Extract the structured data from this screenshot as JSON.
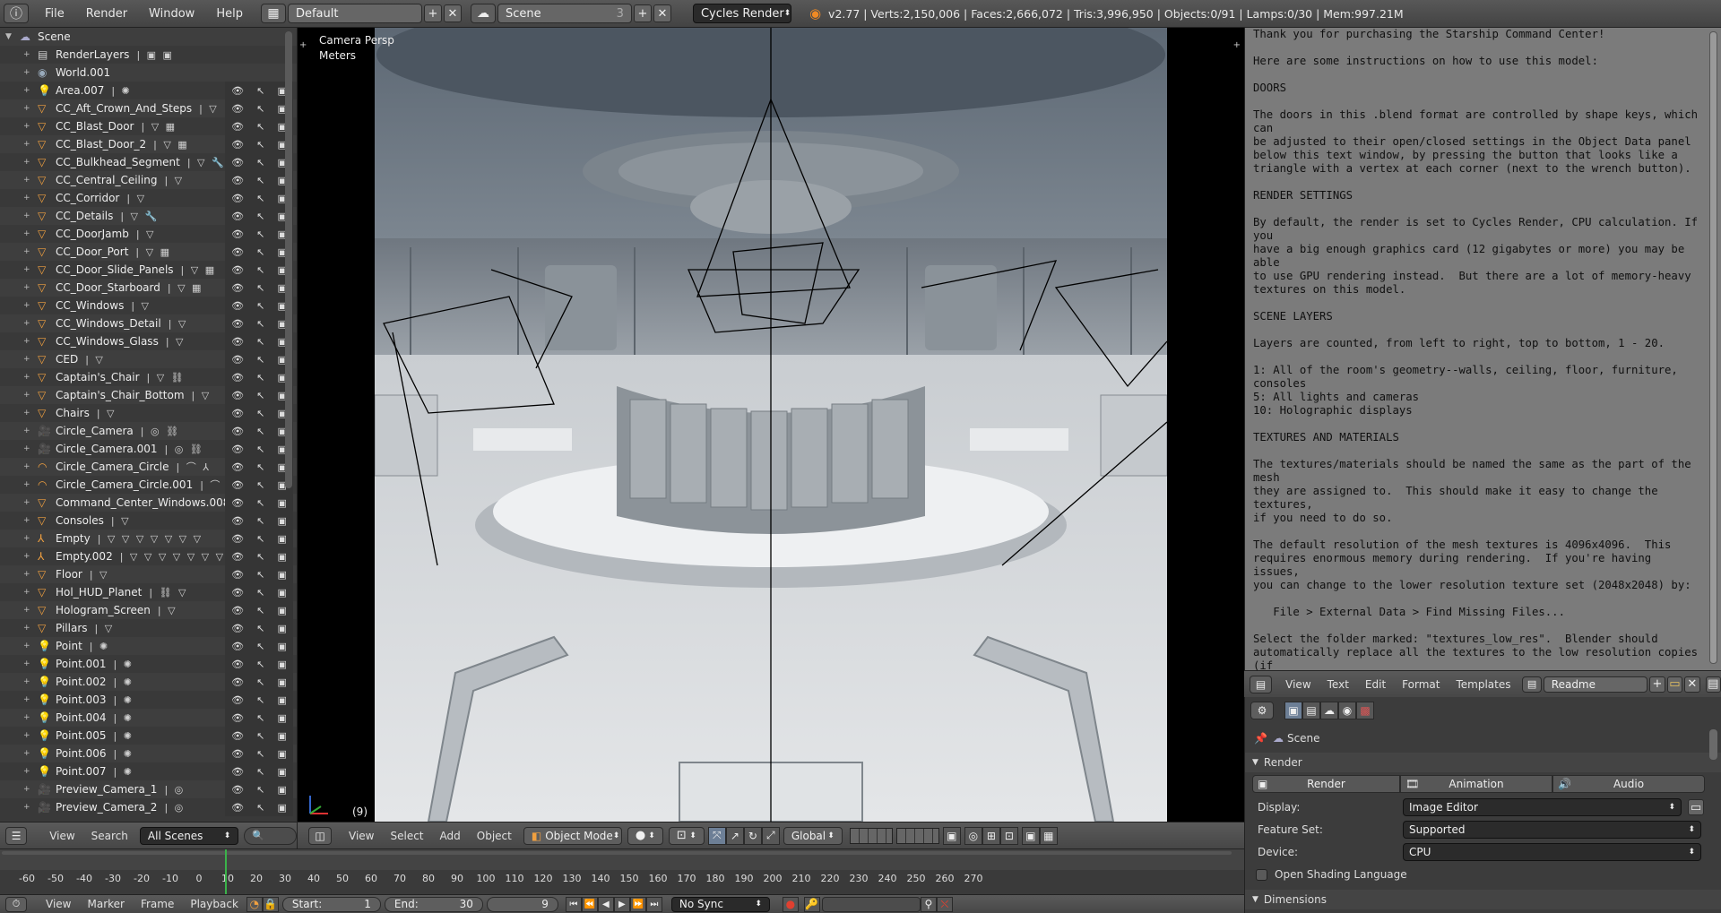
{
  "topbar": {
    "menus": [
      "File",
      "Render",
      "Window",
      "Help"
    ],
    "screen_layout": "Default",
    "scene": "Scene",
    "scene_users": "3",
    "render_engine": "Cycles Render",
    "stats": "v2.77 | Verts:2,150,006 | Faces:2,666,072 | Tris:3,996,950 | Objects:0/91 | Lamps:0/30 | Mem:997.21M"
  },
  "outliner": {
    "root": "Scene",
    "rows": [
      {
        "name": "RenderLayers",
        "icon": "renderlayers-icon",
        "glyph": "▤",
        "color": "#cfcfcf",
        "sub": "▣ ▣",
        "vis": false
      },
      {
        "name": "World.001",
        "icon": "world-icon",
        "glyph": "◉",
        "color": "#9ab",
        "sub": "",
        "vis": false
      },
      {
        "name": "Area.007",
        "icon": "lamp-icon",
        "glyph": "💡",
        "color": "#f0c060",
        "sub": "✺",
        "vis": true
      },
      {
        "name": "CC_Aft_Crown_And_Steps",
        "icon": "mesh-icon",
        "glyph": "▽",
        "color": "#f0a040",
        "sub": "▽",
        "vis": true
      },
      {
        "name": "CC_Blast_Door",
        "icon": "mesh-icon",
        "glyph": "▽",
        "color": "#f0a040",
        "sub": "▽ ▦",
        "vis": true
      },
      {
        "name": "CC_Blast_Door_2",
        "icon": "mesh-icon",
        "glyph": "▽",
        "color": "#f0a040",
        "sub": "▽ ▦",
        "vis": true
      },
      {
        "name": "CC_Bulkhead_Segment",
        "icon": "mesh-icon",
        "glyph": "▽",
        "color": "#f0a040",
        "sub": "▽ 🔧",
        "vis": true
      },
      {
        "name": "CC_Central_Ceiling",
        "icon": "mesh-icon",
        "glyph": "▽",
        "color": "#f0a040",
        "sub": "▽",
        "vis": true
      },
      {
        "name": "CC_Corridor",
        "icon": "mesh-icon",
        "glyph": "▽",
        "color": "#f0a040",
        "sub": "▽",
        "vis": true
      },
      {
        "name": "CC_Details",
        "icon": "mesh-icon",
        "glyph": "▽",
        "color": "#f0a040",
        "sub": "▽ 🔧",
        "vis": true
      },
      {
        "name": "CC_DoorJamb",
        "icon": "mesh-icon",
        "glyph": "▽",
        "color": "#f0a040",
        "sub": "▽",
        "vis": true
      },
      {
        "name": "CC_Door_Port",
        "icon": "mesh-icon",
        "glyph": "▽",
        "color": "#f0a040",
        "sub": "▽ ▦",
        "vis": true
      },
      {
        "name": "CC_Door_Slide_Panels",
        "icon": "mesh-icon",
        "glyph": "▽",
        "color": "#f0a040",
        "sub": "▽ ▦",
        "vis": true
      },
      {
        "name": "CC_Door_Starboard",
        "icon": "mesh-icon",
        "glyph": "▽",
        "color": "#f0a040",
        "sub": "▽ ▦",
        "vis": true
      },
      {
        "name": "CC_Windows",
        "icon": "mesh-icon",
        "glyph": "▽",
        "color": "#f0a040",
        "sub": "▽",
        "vis": true
      },
      {
        "name": "CC_Windows_Detail",
        "icon": "mesh-icon",
        "glyph": "▽",
        "color": "#f0a040",
        "sub": "▽",
        "vis": true
      },
      {
        "name": "CC_Windows_Glass",
        "icon": "mesh-icon",
        "glyph": "▽",
        "color": "#f0a040",
        "sub": "▽",
        "vis": true
      },
      {
        "name": "CED",
        "icon": "mesh-icon",
        "glyph": "▽",
        "color": "#f0a040",
        "sub": "▽",
        "vis": true
      },
      {
        "name": "Captain's_Chair",
        "icon": "mesh-icon",
        "glyph": "▽",
        "color": "#f0a040",
        "sub": "▽ ⛓",
        "vis": true
      },
      {
        "name": "Captain's_Chair_Bottom",
        "icon": "mesh-icon",
        "glyph": "▽",
        "color": "#f0a040",
        "sub": "▽",
        "vis": true
      },
      {
        "name": "Chairs",
        "icon": "mesh-icon",
        "glyph": "▽",
        "color": "#f0a040",
        "sub": "▽",
        "vis": true
      },
      {
        "name": "Circle_Camera",
        "icon": "camera-icon",
        "glyph": "🎥",
        "color": "#f0a040",
        "sub": "◎ ⛓",
        "vis": true
      },
      {
        "name": "Circle_Camera.001",
        "icon": "camera-icon",
        "glyph": "🎥",
        "color": "#f0a040",
        "sub": "◎ ⛓",
        "vis": true
      },
      {
        "name": "Circle_Camera_Circle",
        "icon": "curve-icon",
        "glyph": "◠",
        "color": "#f0a040",
        "sub": "⌒ ⅄",
        "vis": true
      },
      {
        "name": "Circle_Camera_Circle.001",
        "icon": "curve-icon",
        "glyph": "◠",
        "color": "#f0a040",
        "sub": "⌒ ⅄",
        "vis": true
      },
      {
        "name": "Command_Center_Windows.008",
        "icon": "mesh-icon",
        "glyph": "▽",
        "color": "#f0a040",
        "sub": "▽",
        "vis": true
      },
      {
        "name": "Consoles",
        "icon": "mesh-icon",
        "glyph": "▽",
        "color": "#f0a040",
        "sub": "▽",
        "vis": true
      },
      {
        "name": "Empty",
        "icon": "empty-icon",
        "glyph": "⅄",
        "color": "#f0a040",
        "sub": "▽ ▽ ▽ ▽ ▽ ▽ ▽",
        "vis": true
      },
      {
        "name": "Empty.002",
        "icon": "empty-icon",
        "glyph": "⅄",
        "color": "#f0a040",
        "sub": "▽ ▽ ▽ ▽ ▽ ▽ ▽",
        "vis": true
      },
      {
        "name": "Floor",
        "icon": "mesh-icon",
        "glyph": "▽",
        "color": "#f0a040",
        "sub": "▽",
        "vis": true
      },
      {
        "name": "Hol_HUD_Planet",
        "icon": "mesh-icon",
        "glyph": "▽",
        "color": "#f0a040",
        "sub": "⛓ ▽",
        "vis": true
      },
      {
        "name": "Hologram_Screen",
        "icon": "mesh-icon",
        "glyph": "▽",
        "color": "#f0a040",
        "sub": "▽",
        "vis": true
      },
      {
        "name": "Pillars",
        "icon": "mesh-icon",
        "glyph": "▽",
        "color": "#f0a040",
        "sub": "▽",
        "vis": true
      },
      {
        "name": "Point",
        "icon": "lamp-icon",
        "glyph": "💡",
        "color": "#f0c060",
        "sub": "✺",
        "vis": true
      },
      {
        "name": "Point.001",
        "icon": "lamp-icon",
        "glyph": "💡",
        "color": "#f0c060",
        "sub": "✺",
        "vis": true
      },
      {
        "name": "Point.002",
        "icon": "lamp-icon",
        "glyph": "💡",
        "color": "#f0c060",
        "sub": "✺",
        "vis": true
      },
      {
        "name": "Point.003",
        "icon": "lamp-icon",
        "glyph": "💡",
        "color": "#f0c060",
        "sub": "✺",
        "vis": true
      },
      {
        "name": "Point.004",
        "icon": "lamp-icon",
        "glyph": "💡",
        "color": "#f0c060",
        "sub": "✺",
        "vis": true
      },
      {
        "name": "Point.005",
        "icon": "lamp-icon",
        "glyph": "💡",
        "color": "#f0c060",
        "sub": "✺",
        "vis": true
      },
      {
        "name": "Point.006",
        "icon": "lamp-icon",
        "glyph": "💡",
        "color": "#f0c060",
        "sub": "✺",
        "vis": true
      },
      {
        "name": "Point.007",
        "icon": "lamp-icon",
        "glyph": "💡",
        "color": "#f0c060",
        "sub": "✺",
        "vis": true
      },
      {
        "name": "Preview_Camera_1",
        "icon": "camera-icon",
        "glyph": "🎥",
        "color": "#f0a040",
        "sub": "◎",
        "vis": true
      },
      {
        "name": "Preview_Camera_2",
        "icon": "camera-icon",
        "glyph": "🎥",
        "color": "#f0a040",
        "sub": "◎",
        "vis": true
      }
    ]
  },
  "viewport": {
    "view_name": "Camera Persp",
    "units": "Meters",
    "frame_label": "(9)"
  },
  "viewport_header": {
    "menus": [
      "View",
      "Select",
      "Add",
      "Object"
    ],
    "mode": "Object Mode",
    "orientation": "Global"
  },
  "outliner_header": {
    "menus": [
      "View",
      "Search"
    ],
    "filter": "All Scenes"
  },
  "text_editor": {
    "content": "Thank you for purchasing the Starship Command Center!\n\nHere are some instructions on how to use this model:\n\nDOORS\n\nThe doors in this .blend format are controlled by shape keys, which can\nbe adjusted to their open/closed settings in the Object Data panel\nbelow this text window, by pressing the button that looks like a\ntriangle with a vertex at each corner (next to the wrench button).\n\nRENDER SETTINGS\n\nBy default, the render is set to Cycles Render, CPU calculation. If you\nhave a big enough graphics card (12 gigabytes or more) you may be able\nto use GPU rendering instead.  But there are a lot of memory-heavy\ntextures on this model.\n\nSCENE LAYERS\n\nLayers are counted, from left to right, top to bottom, 1 - 20.\n\n1: All of the room's geometry--walls, ceiling, floor, furniture,\nconsoles\n5: All lights and cameras\n10: Holographic displays\n\nTEXTURES AND MATERIALS\n\nThe textures/materials should be named the same as the part of the mesh\nthey are assigned to.  This should make it easy to change the textures,\nif you need to do so.\n\nThe default resolution of the mesh textures is 4096x4096.  This\nrequires enormous memory during rendering.  If you're having issues,\nyou can change to the lower resolution texture set (2048x2048) by:\n\n   File > External Data > Find Missing Files...\n\nSelect the folder marked: \"textures_low_res\".  Blender should\nautomatically replace all the textures to the low resolution copies (if\nthere is a low-res alternative).  If it does not have a low-res\nversion, Blender will keep using the current texture.\n\nIf you have Substance Painter 2 (or later) you can open the .spp\nproject files included in the purchase of this model to change the\ntextures pretty quickly and easily (depending on your knowledge of\nSubstance Painter)."
  },
  "text_header": {
    "menus": [
      "View",
      "Text",
      "Edit",
      "Format",
      "Templates"
    ],
    "datablock": "Readme"
  },
  "properties": {
    "context": "Scene",
    "panel_render": "Render",
    "buttons": {
      "render": "Render",
      "animation": "Animation",
      "audio": "Audio"
    },
    "display_label": "Display:",
    "display_value": "Image Editor",
    "feature_label": "Feature Set:",
    "feature_value": "Supported",
    "device_label": "Device:",
    "device_value": "CPU",
    "osl_label": "Open Shading Language",
    "panel_dimensions": "Dimensions"
  },
  "timeline": {
    "ticks": [
      "-60",
      "-50",
      "-40",
      "-30",
      "-20",
      "-10",
      "0",
      "10",
      "20",
      "30",
      "40",
      "50",
      "60",
      "70",
      "80",
      "90",
      "100",
      "110",
      "120",
      "130",
      "140",
      "150",
      "160",
      "170",
      "180",
      "190",
      "200",
      "210",
      "220",
      "230",
      "240",
      "250",
      "260",
      "270"
    ],
    "current_frame": 9
  },
  "timeline_header": {
    "menus": [
      "View",
      "Marker",
      "Frame",
      "Playback"
    ],
    "start_label": "Start:",
    "start_value": "1",
    "end_label": "End:",
    "end_value": "30",
    "frame_value": "9",
    "sync": "No Sync"
  }
}
